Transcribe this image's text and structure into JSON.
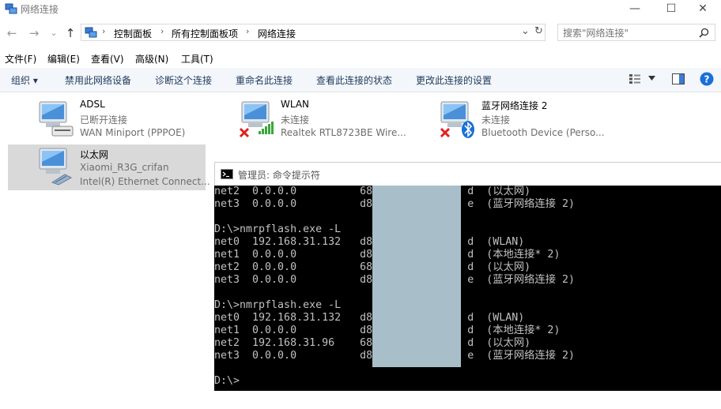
{
  "window": {
    "title": "网络连接",
    "minimize": "—",
    "maximize": "☐",
    "close": "✕"
  },
  "nav": {
    "back": "←",
    "forward": "→",
    "dropdown": "⌄",
    "up": "↑"
  },
  "address": {
    "crumbs": [
      "控制面板",
      "所有控制面板项",
      "网络连接"
    ],
    "separator": "›",
    "dropdown": "⌄",
    "refresh": "↻"
  },
  "search": {
    "placeholder": "搜索\"网络连接\""
  },
  "menubar": [
    "文件(F)",
    "编辑(E)",
    "查看(V)",
    "高级(N)",
    "工具(T)"
  ],
  "commands": [
    "组织 ▾",
    "禁用此网络设备",
    "诊断这个连接",
    "重命名此连接",
    "查看此连接的状态",
    "更改此连接的设置"
  ],
  "connections": [
    {
      "name": "ADSL",
      "status": "已断开连接",
      "device": "WAN Miniport (PPPOE)"
    },
    {
      "name": "WLAN",
      "status": "未连接",
      "device": "Realtek RTL8723BE Wire..."
    },
    {
      "name": "蓝牙网络连接 2",
      "status": "未连接",
      "device": "Bluetooth Device (Perso..."
    },
    {
      "name": "以太网",
      "status": "Xiaomi_R3G_crifan",
      "device": "Intel(R) Ethernet Connect..."
    }
  ],
  "console": {
    "title": "管理员: 命令提示符",
    "lines": [
      "net2  0.0.0.0          68               d  (以太网)",
      "net3  0.0.0.0          d8               e  (蓝牙网络连接 2)",
      "",
      "D:\\>nmrpflash.exe -L",
      "net0  192.168.31.132   d8               d  (WLAN)",
      "net1  0.0.0.0          d8               d  (本地连接* 2)",
      "net2  0.0.0.0          68               d  (以太网)",
      "net3  0.0.0.0          d8               e  (蓝牙网络连接 2)",
      "",
      "D:\\>nmrpflash.exe -L",
      "net0  192.168.31.132   d8               d  (WLAN)",
      "net1  0.0.0.0          d8               d  (本地连接* 2)",
      "net2  192.168.31.96    68               d  (以太网)",
      "net3  0.0.0.0          d8               e  (蓝牙网络连接 2)",
      "",
      "D:\\>"
    ]
  },
  "colors": {
    "redaction": "#a8bfc9",
    "selection": "#d9d9d9",
    "command_text": "#1e395b"
  }
}
